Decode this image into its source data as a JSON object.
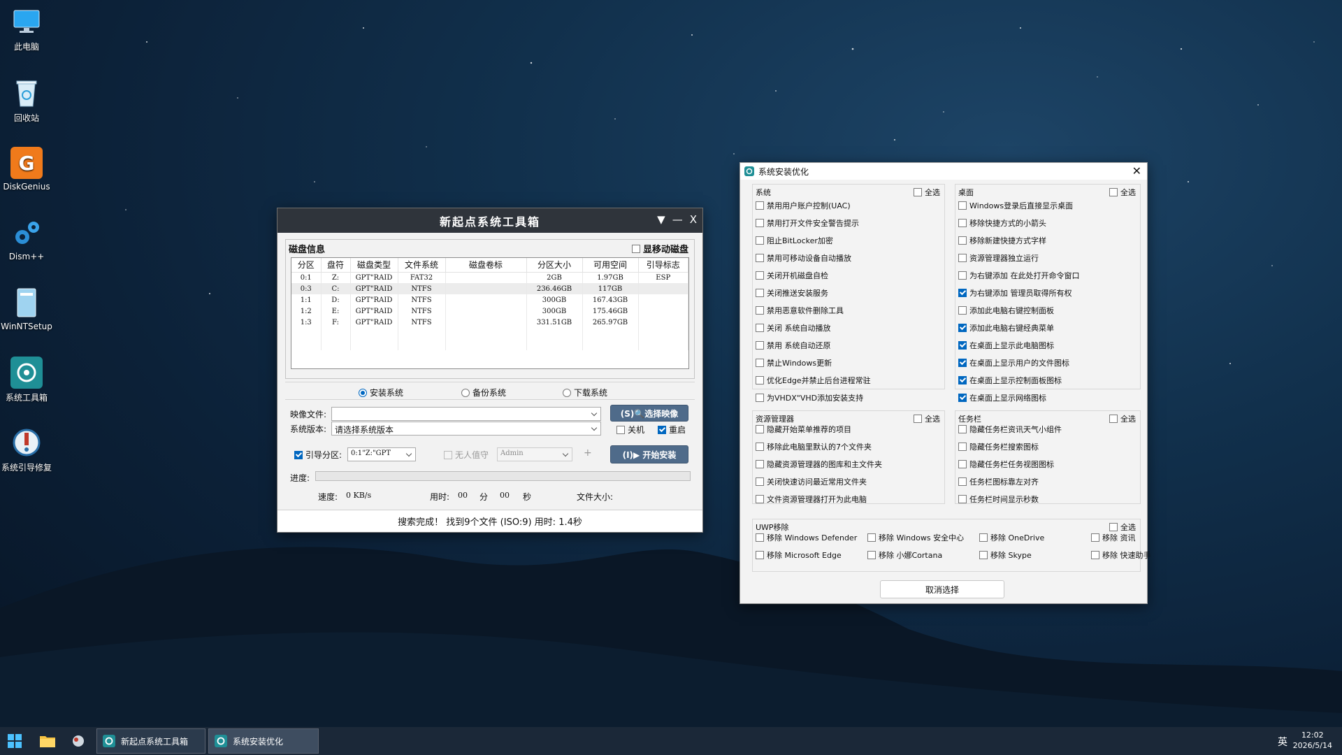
{
  "desktop": {
    "icons": [
      {
        "label": "此电脑",
        "icon": "monitor-icon"
      },
      {
        "label": "回收站",
        "icon": "recycle-bin-icon"
      },
      {
        "label": "DiskGenius",
        "icon": "diskgenius-icon"
      },
      {
        "label": "Dism++",
        "icon": "gears-icon"
      },
      {
        "label": "WinNTSetup",
        "icon": "setup-icon"
      },
      {
        "label": "系统工具箱",
        "icon": "toolbox-icon"
      },
      {
        "label": "系统引导修复",
        "icon": "boot-repair-icon"
      }
    ]
  },
  "toolbox": {
    "title": "新起点系统工具箱",
    "controls": {
      "menu": "▼",
      "minimize": "—",
      "close": "X"
    },
    "disk_info_label": "磁盘信息",
    "show_mobile_label": "显移动磁盘",
    "table": {
      "headers": [
        "分区",
        "盘符",
        "磁盘类型",
        "文件系统",
        "磁盘卷标",
        "分区大小",
        "可用空间",
        "引导标志"
      ],
      "rows": [
        [
          "0:1",
          "Z:",
          "GPT\"RAID",
          "FAT32",
          "",
          "2GB",
          "1.97GB",
          "ESP"
        ],
        [
          "0:3",
          "C:",
          "GPT\"RAID",
          "NTFS",
          "",
          "236.46GB",
          "117GB",
          ""
        ],
        [
          "1:1",
          "D:",
          "GPT\"RAID",
          "NTFS",
          "",
          "300GB",
          "167.43GB",
          ""
        ],
        [
          "1:2",
          "E:",
          "GPT\"RAID",
          "NTFS",
          "",
          "300GB",
          "175.46GB",
          ""
        ],
        [
          "1:3",
          "F:",
          "GPT\"RAID",
          "NTFS",
          "",
          "331.51GB",
          "265.97GB",
          ""
        ]
      ],
      "selected_row": 1
    },
    "modes": {
      "install": "安装系统",
      "backup": "备份系统",
      "download": "下载系统"
    },
    "image_file_label": "映像文件:",
    "image_file_value": "",
    "select_image_button": "(S)🔍选择映像",
    "version_label": "系统版本:",
    "version_value": "请选择系统版本",
    "shutdown_label": "关机",
    "restart_label": "重启",
    "boot_partition_label": "引导分区:",
    "boot_partition_value": "0:1\"Z:\"GPT",
    "unattended_label": "无人值守",
    "user_value": "Admin",
    "plus": "+",
    "start_install_button": "(I)▶ 开始安装",
    "progress_label": "进度:",
    "progress": 0,
    "speed_label": "速度:",
    "speed_value": "0 KB/s",
    "elapsed_label": "用时:",
    "elapsed_min": "00",
    "min_unit": "分",
    "elapsed_sec": "00",
    "sec_unit": "秒",
    "filesize_label": "文件大小:",
    "status": "搜索完成！ 找到9个文件 (ISO:9) 用时: 1.4秒"
  },
  "optimizer": {
    "title": "系统安装优化",
    "close": "✕",
    "select_all": "全选",
    "groups": {
      "system": {
        "title": "系统",
        "items": [
          {
            "label": "禁用用户账户控制(UAC)",
            "checked": false
          },
          {
            "label": "禁用打开文件安全警告提示",
            "checked": false
          },
          {
            "label": "阻止BitLocker加密",
            "checked": false
          },
          {
            "label": "禁用可移动设备自动播放",
            "checked": false
          },
          {
            "label": "关闭开机磁盘自检",
            "checked": false
          },
          {
            "label": "关闭推送安装服务",
            "checked": false
          },
          {
            "label": "禁用恶意软件删除工具",
            "checked": false
          },
          {
            "label": "关闭 系统自动播放",
            "checked": false
          },
          {
            "label": "禁用 系统自动还原",
            "checked": false
          },
          {
            "label": "禁止Windows更新",
            "checked": false
          },
          {
            "label": "优化Edge并禁止后台进程常驻",
            "checked": false
          },
          {
            "label": "为VHDX\"VHD添加安装支持",
            "checked": false
          }
        ]
      },
      "desktop": {
        "title": "桌面",
        "items": [
          {
            "label": "Windows登录后直接显示桌面",
            "checked": false
          },
          {
            "label": "移除快捷方式的小箭头",
            "checked": false
          },
          {
            "label": "移除新建快捷方式字样",
            "checked": false
          },
          {
            "label": "资源管理器独立运行",
            "checked": false
          },
          {
            "label": "为右键添加 在此处打开命令窗口",
            "checked": false
          },
          {
            "label": "为右键添加 管理员取得所有权",
            "checked": true
          },
          {
            "label": "添加此电脑右键控制面板",
            "checked": false
          },
          {
            "label": "添加此电脑右键经典菜单",
            "checked": true
          },
          {
            "label": "在桌面上显示此电脑图标",
            "checked": true
          },
          {
            "label": "在桌面上显示用户的文件图标",
            "checked": true
          },
          {
            "label": "在桌面上显示控制面板图标",
            "checked": true
          },
          {
            "label": "在桌面上显示网络图标",
            "checked": true
          }
        ]
      },
      "explorer": {
        "title": "资源管理器",
        "items": [
          {
            "label": "隐藏开始菜单推荐的项目",
            "checked": false
          },
          {
            "label": "移除此电脑里默认的7个文件夹",
            "checked": false
          },
          {
            "label": "隐藏资源管理器的图库和主文件夹",
            "checked": false
          },
          {
            "label": "关闭快速访问最近常用文件夹",
            "checked": false
          },
          {
            "label": "文件资源管理器打开为此电脑",
            "checked": false
          }
        ]
      },
      "taskbar": {
        "title": "任务栏",
        "items": [
          {
            "label": "隐藏任务栏资讯天气小组件",
            "checked": false
          },
          {
            "label": "隐藏任务栏搜索图标",
            "checked": false
          },
          {
            "label": "隐藏任务栏任务视图图标",
            "checked": false
          },
          {
            "label": "任务栏图标靠左对齐",
            "checked": false
          },
          {
            "label": "任务栏时间显示秒数",
            "checked": false
          }
        ]
      },
      "uwp": {
        "title": "UWP移除",
        "items": [
          {
            "label": "移除 Windows Defender",
            "checked": false
          },
          {
            "label": "移除 Windows 安全中心",
            "checked": false
          },
          {
            "label": "移除 OneDrive",
            "checked": false
          },
          {
            "label": "移除 资讯",
            "checked": false
          },
          {
            "label": "移除 Microsoft Edge",
            "checked": false
          },
          {
            "label": "移除 小娜Cortana",
            "checked": false
          },
          {
            "label": "移除 Skype",
            "checked": false
          },
          {
            "label": "移除 快速助手",
            "checked": false
          }
        ]
      }
    },
    "cancel_button": "取消选择"
  },
  "taskbar": {
    "apps": [
      {
        "label": "新起点系统工具箱"
      },
      {
        "label": "系统安装优化"
      }
    ],
    "ime": "英",
    "time": "12:02",
    "date": "2026/5/14"
  }
}
